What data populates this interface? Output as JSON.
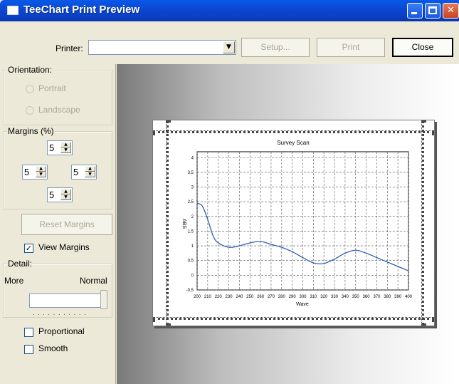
{
  "window": {
    "title": "TeeChart Print Preview"
  },
  "toolbar": {
    "printer_label": "Printer:",
    "printer_value": "",
    "setup_label": "Setup...",
    "print_label": "Print",
    "close_label": "Close"
  },
  "orientation": {
    "label": "Orientation:",
    "portrait": "Portrait",
    "landscape": "Landscape"
  },
  "margins": {
    "label": "Margins (%)",
    "top": "5",
    "left": "5",
    "right": "5",
    "bottom": "5",
    "reset_label": "Reset Margins",
    "view_margins_label": "View Margins",
    "view_margins_checked": true
  },
  "detail": {
    "label": "Detail:",
    "more_label": "More",
    "normal_label": "Normal",
    "level": 1.0
  },
  "options": {
    "proportional_label": "Proportional",
    "proportional_checked": false,
    "smooth_label": "Smooth",
    "smooth_checked": false
  },
  "chart_data": {
    "type": "line",
    "title": "Survey Scan",
    "xlabel": "Wave",
    "ylabel": "ABS",
    "xlim": [
      200,
      400
    ],
    "ylim": [
      -0.5,
      4.2
    ],
    "x_ticks": [
      "200",
      "210",
      "220",
      "230",
      "240",
      "250",
      "260",
      "270",
      "280",
      "290",
      "300",
      "310",
      "320",
      "330",
      "340",
      "350",
      "360",
      "370",
      "380",
      "390",
      "400"
    ],
    "y_ticks": [
      "-0.5",
      "0",
      "0.5",
      "1",
      "1.5",
      "2",
      "2.5",
      "3",
      "3.5",
      "4"
    ],
    "grid": true,
    "x": [
      200,
      205,
      210,
      215,
      220,
      230,
      240,
      250,
      260,
      270,
      280,
      290,
      300,
      310,
      320,
      330,
      340,
      350,
      360,
      370,
      380,
      390,
      400
    ],
    "y": [
      2.45,
      2.35,
      1.9,
      1.35,
      1.1,
      0.95,
      1.0,
      1.1,
      1.15,
      1.05,
      0.95,
      0.8,
      0.6,
      0.42,
      0.4,
      0.55,
      0.75,
      0.85,
      0.75,
      0.6,
      0.45,
      0.3,
      0.15
    ],
    "color": "#3060b0"
  }
}
